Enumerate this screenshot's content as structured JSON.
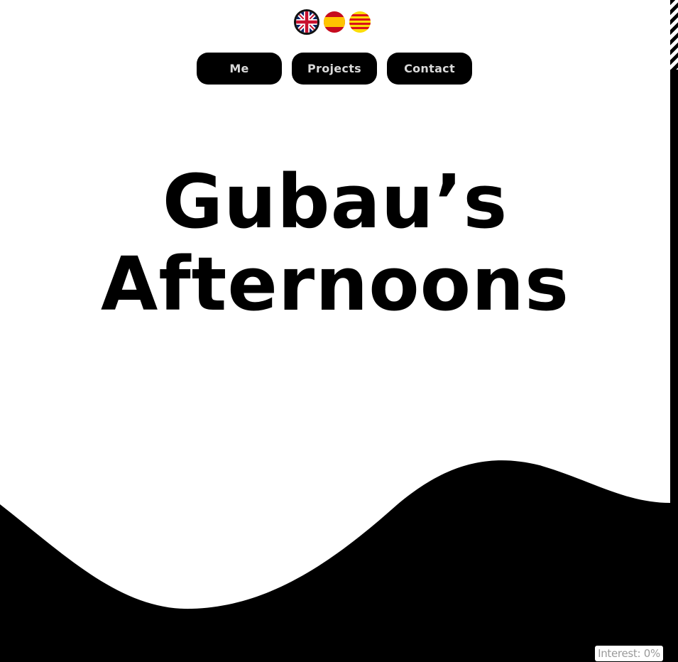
{
  "languages": [
    {
      "code": "en",
      "icon": "uk-flag-icon",
      "active": true
    },
    {
      "code": "es",
      "icon": "spain-flag-icon",
      "active": false
    },
    {
      "code": "ca",
      "icon": "catalonia-flag-icon",
      "active": false
    }
  ],
  "nav": {
    "me_label": "Me",
    "projects_label": "Projects",
    "contact_label": "Contact"
  },
  "hero": {
    "title_line1": "Gubau’s",
    "title_line2": "Afternoons"
  },
  "status": {
    "interest_text": "Interest: 0%"
  },
  "colors": {
    "background": "#ffffff",
    "foreground": "#000000",
    "button_text": "#d9d9d9"
  }
}
